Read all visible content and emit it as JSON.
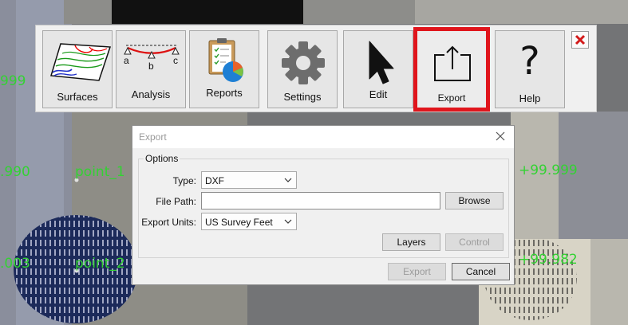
{
  "toolbar": {
    "buttons": [
      {
        "id": "surfaces",
        "label": "Surfaces",
        "icon": "surfaces-contour-icon"
      },
      {
        "id": "analysis",
        "label": "Analysis",
        "icon": "analysis-profile-icon",
        "markers": [
          "a",
          "b",
          "c"
        ]
      },
      {
        "id": "reports",
        "label": "Reports",
        "icon": "reports-clipboard-icon"
      },
      {
        "id": "settings",
        "label": "Settings",
        "icon": "gear-icon"
      },
      {
        "id": "edit",
        "label": "Edit",
        "icon": "cursor-arrow-icon"
      },
      {
        "id": "export",
        "label": "Export",
        "icon": "export-tray-icon",
        "highlighted": true
      },
      {
        "id": "help",
        "label": "Help",
        "icon": "question-mark-icon"
      }
    ],
    "close_icon": "close-icon",
    "highlight_color": "#e0151c"
  },
  "map": {
    "labels": [
      "999",
      ".990",
      "point_1",
      "+99.999",
      ".003",
      "point_2",
      "+99.982"
    ],
    "label_color": "#33d233"
  },
  "dialog": {
    "title": "Export",
    "group_title": "Options",
    "type_label": "Type:",
    "type_value": "DXF",
    "file_path_label": "File Path:",
    "file_path_value": "",
    "browse_label": "Browse",
    "units_label": "Export Units:",
    "units_value": "US Survey Feet",
    "layers_label": "Layers",
    "control_label": "Control",
    "export_label": "Export",
    "cancel_label": "Cancel"
  }
}
